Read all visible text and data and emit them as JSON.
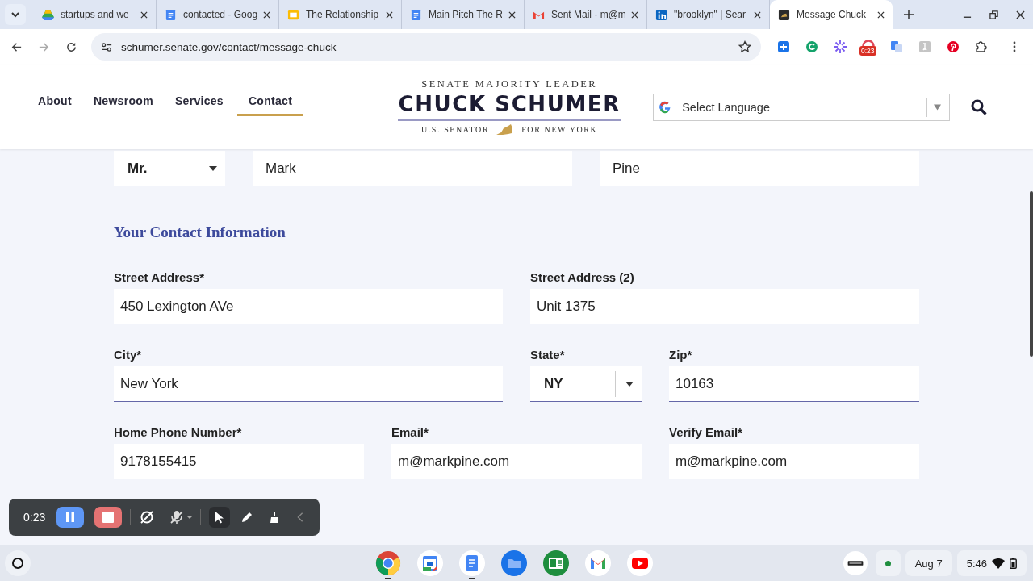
{
  "browser": {
    "tabs": [
      {
        "title": "startups and we",
        "kind": "drive",
        "selected": false
      },
      {
        "title": "contacted - Goog",
        "kind": "docs",
        "selected": false
      },
      {
        "title": "The Relationship",
        "kind": "slides",
        "selected": false
      },
      {
        "title": "Main Pitch The R",
        "kind": "docs",
        "selected": false
      },
      {
        "title": "Sent Mail - m@m",
        "kind": "gmail",
        "selected": false
      },
      {
        "title": "\"brooklyn\" | Sear",
        "kind": "linkedin",
        "selected": false
      },
      {
        "title": "Message Chuck",
        "kind": "senate",
        "selected": true
      }
    ],
    "url": "schumer.senate.gov/contact/message-chuck",
    "extensions": [
      {
        "kind": "plus"
      },
      {
        "kind": "grammar"
      },
      {
        "kind": "sun"
      },
      {
        "kind": "record",
        "badge": "0:23"
      },
      {
        "kind": "translate"
      },
      {
        "kind": "gray"
      },
      {
        "kind": "pin"
      },
      {
        "kind": "puzzle"
      }
    ]
  },
  "site": {
    "nav": [
      {
        "label": "About",
        "selected": false
      },
      {
        "label": "Newsroom",
        "selected": false
      },
      {
        "label": "Services",
        "selected": false
      },
      {
        "label": "Contact",
        "selected": true
      }
    ],
    "logo": {
      "top": "SENATE MAJORITY LEADER",
      "name": "CHUCK SCHUMER",
      "left": "U.S. SENATOR",
      "right": "FOR NEW YORK"
    },
    "language_select": {
      "placeholder": "Select Language"
    }
  },
  "form": {
    "name_row": [
      {
        "kind": "select",
        "value": "Mr."
      },
      {
        "kind": "input",
        "value": "Mark"
      },
      {
        "kind": "input",
        "value": "Pine"
      }
    ],
    "section_title": "Your Contact Information",
    "rows": [
      [
        {
          "label": "Street Address*",
          "kind": "input",
          "value": "450 Lexington AVe"
        },
        {
          "label": "Street Address (2)",
          "kind": "input",
          "value": "Unit 1375"
        }
      ],
      [
        {
          "label": "City*",
          "kind": "input",
          "value": "New York"
        },
        {
          "label": "State*",
          "kind": "select",
          "value": "NY"
        },
        {
          "label": "Zip*",
          "kind": "input",
          "value": "10163"
        }
      ],
      [
        {
          "label": "Home Phone Number*",
          "kind": "input",
          "value": "9178155415"
        },
        {
          "label": "Email*",
          "kind": "input",
          "value": "m@markpine.com"
        },
        {
          "label": "Verify Email*",
          "kind": "input",
          "value": "m@markpine.com"
        }
      ]
    ]
  },
  "recorder": {
    "time": "0:23",
    "tools": [
      {
        "kind": "pointer",
        "selected": true
      },
      {
        "kind": "pen",
        "selected": false
      },
      {
        "kind": "eraser",
        "selected": false
      }
    ]
  },
  "taskbar": {
    "apps": [
      {
        "kind": "chrome",
        "open": true
      },
      {
        "kind": "calendar",
        "open": false
      },
      {
        "kind": "docs",
        "open": true
      },
      {
        "kind": "files",
        "open": false
      },
      {
        "kind": "classroom",
        "open": false
      },
      {
        "kind": "gmail",
        "open": false
      },
      {
        "kind": "youtube",
        "open": false
      }
    ],
    "date": "Aug 7",
    "time": "5:46"
  }
}
